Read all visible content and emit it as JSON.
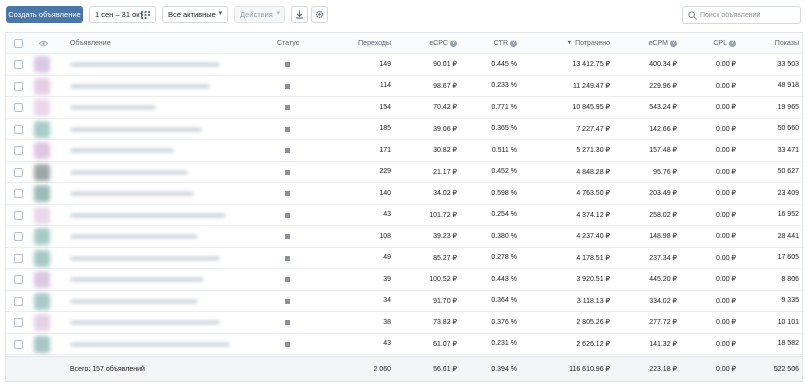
{
  "toolbar": {
    "create_label": "Создать объявление",
    "date_range": "1 сен – 31 окт",
    "filter_value": "Все активные",
    "actions_label": "Действия",
    "search_placeholder": "Поиск объявлений"
  },
  "table": {
    "columns": {
      "ad": "Объявление",
      "status": "Статус",
      "clicks": "Переходы",
      "ecpc": "eCPC",
      "ctr": "CTR",
      "spent": "Потрачено",
      "ecpm": "eCPM",
      "cpl": "CPL",
      "impressions": "Показы"
    },
    "rows": [
      {
        "clicks": "149",
        "ecpc": "90.01 ₽",
        "ctr": "0.445 %",
        "spent": "13 412.75 ₽",
        "ecpm": "400.34 ₽",
        "cpl": "0.00 ₽",
        "impressions": "33 503"
      },
      {
        "clicks": "114",
        "ecpc": "98.67 ₽",
        "ctr": "0.233 %",
        "spent": "11 249.47 ₽",
        "ecpm": "229.96 ₽",
        "cpl": "0.00 ₽",
        "impressions": "48 918"
      },
      {
        "clicks": "154",
        "ecpc": "70.42 ₽",
        "ctr": "0.771 %",
        "spent": "10 845.95 ₽",
        "ecpm": "543.24 ₽",
        "cpl": "0.00 ₽",
        "impressions": "19 965"
      },
      {
        "clicks": "185",
        "ecpc": "39.06 ₽",
        "ctr": "0.365 %",
        "spent": "7 227.47 ₽",
        "ecpm": "142.66 ₽",
        "cpl": "0.00 ₽",
        "impressions": "50 660"
      },
      {
        "clicks": "171",
        "ecpc": "30.82 ₽",
        "ctr": "0.511 %",
        "spent": "5 271.30 ₽",
        "ecpm": "157.48 ₽",
        "cpl": "0.00 ₽",
        "impressions": "33 471"
      },
      {
        "clicks": "229",
        "ecpc": "21.17 ₽",
        "ctr": "0.452 %",
        "spent": "4 848.28 ₽",
        "ecpm": "95.76 ₽",
        "cpl": "0.00 ₽",
        "impressions": "50 627"
      },
      {
        "clicks": "140",
        "ecpc": "34.02 ₽",
        "ctr": "0.598 %",
        "spent": "4 763.50 ₽",
        "ecpm": "203.49 ₽",
        "cpl": "0.00 ₽",
        "impressions": "23 409"
      },
      {
        "clicks": "43",
        "ecpc": "101.72 ₽",
        "ctr": "0.254 %",
        "spent": "4 374.12 ₽",
        "ecpm": "258.02 ₽",
        "cpl": "0.00 ₽",
        "impressions": "16 952"
      },
      {
        "clicks": "108",
        "ecpc": "39.23 ₽",
        "ctr": "0.380 %",
        "spent": "4 237.40 ₽",
        "ecpm": "148.98 ₽",
        "cpl": "0.00 ₽",
        "impressions": "28 441"
      },
      {
        "clicks": "49",
        "ecpc": "85.27 ₽",
        "ctr": "0.278 %",
        "spent": "4 178.51 ₽",
        "ecpm": "237.34 ₽",
        "cpl": "0.00 ₽",
        "impressions": "17 605"
      },
      {
        "clicks": "39",
        "ecpc": "100.52 ₽",
        "ctr": "0.443 %",
        "spent": "3 920.51 ₽",
        "ecpm": "445.20 ₽",
        "cpl": "0.00 ₽",
        "impressions": "8 806"
      },
      {
        "clicks": "34",
        "ecpc": "91.70 ₽",
        "ctr": "0.364 %",
        "spent": "3 118.13 ₽",
        "ecpm": "334.02 ₽",
        "cpl": "0.00 ₽",
        "impressions": "9 335"
      },
      {
        "clicks": "38",
        "ecpc": "73.82 ₽",
        "ctr": "0.376 %",
        "spent": "2 805.26 ₽",
        "ecpm": "277.72 ₽",
        "cpl": "0.00 ₽",
        "impressions": "10 101"
      },
      {
        "clicks": "43",
        "ecpc": "61.07 ₽",
        "ctr": "0.231 %",
        "spent": "2 626.12 ₽",
        "ecpm": "141.32 ₽",
        "cpl": "0.00 ₽",
        "impressions": "18 582"
      }
    ],
    "thumb_colors": [
      "#d9c9e6",
      "#e5cde6",
      "#e9d6ea",
      "#a9ccc8",
      "#dfc6e2",
      "#9ea7a8",
      "#9cbcb9",
      "#ead7ea",
      "#a8cbc6",
      "#a7c9c4",
      "#ddc8e2",
      "#a9cbc8",
      "#e6d1e7",
      "#a6c7c3"
    ],
    "totals": {
      "label": "Всего: 157 объявлений",
      "clicks": "2 060",
      "ecpc": "56.61 ₽",
      "ctr": "0.394 %",
      "spent": "116 610.96 ₽",
      "ecpm": "223.18 ₽",
      "cpl": "0.00 ₽",
      "impressions": "522 506"
    }
  },
  "colors": {
    "primary": "#4a76a8",
    "header_bg": "#fafbfc",
    "total_bg": "#f4f5f7"
  }
}
